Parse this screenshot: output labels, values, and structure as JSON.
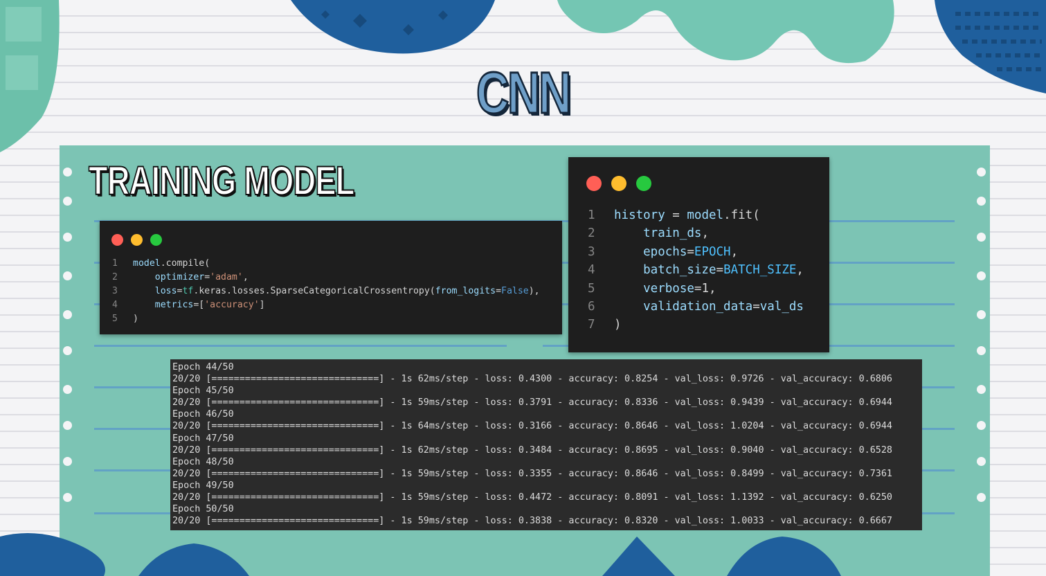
{
  "slide": {
    "title": "CNN",
    "section_title": "TRAINING MODEL"
  },
  "colors": {
    "panel": "#7cc4b4",
    "code_bg": "#1e1e1e",
    "terminal_bg": "#2b2b2b",
    "dot_red": "#ff5f56",
    "dot_yellow": "#ffbd2e",
    "dot_green": "#27c93f",
    "title_fill": "#6f9fc8"
  },
  "compile_code": {
    "lines": [
      {
        "num": "1",
        "tokens": [
          {
            "t": "model",
            "c": "tok-var"
          },
          {
            "t": ".compile(",
            "c": "tok-default"
          }
        ]
      },
      {
        "num": "2",
        "tokens": [
          {
            "t": "    optimizer",
            "c": "tok-var"
          },
          {
            "t": "=",
            "c": "tok-default"
          },
          {
            "t": "'adam'",
            "c": "tok-str"
          },
          {
            "t": ",",
            "c": "tok-default"
          }
        ]
      },
      {
        "num": "3",
        "tokens": [
          {
            "t": "    loss",
            "c": "tok-var"
          },
          {
            "t": "=",
            "c": "tok-default"
          },
          {
            "t": "tf",
            "c": "tok-cls"
          },
          {
            "t": ".keras.losses.SparseCategoricalCrossentropy(",
            "c": "tok-default"
          },
          {
            "t": "from_logits",
            "c": "tok-var"
          },
          {
            "t": "=",
            "c": "tok-default"
          },
          {
            "t": "False",
            "c": "tok-kw"
          },
          {
            "t": "),",
            "c": "tok-default"
          }
        ]
      },
      {
        "num": "4",
        "tokens": [
          {
            "t": "    metrics",
            "c": "tok-var"
          },
          {
            "t": "=[",
            "c": "tok-default"
          },
          {
            "t": "'accuracy'",
            "c": "tok-str"
          },
          {
            "t": "]",
            "c": "tok-default"
          }
        ]
      },
      {
        "num": "5",
        "tokens": [
          {
            "t": ")",
            "c": "tok-default"
          }
        ]
      }
    ]
  },
  "fit_code": {
    "lines": [
      {
        "num": "1",
        "tokens": [
          {
            "t": "history",
            "c": "tok-var"
          },
          {
            "t": " = ",
            "c": "tok-default"
          },
          {
            "t": "model",
            "c": "tok-var"
          },
          {
            "t": ".fit(",
            "c": "tok-default"
          }
        ]
      },
      {
        "num": "2",
        "tokens": [
          {
            "t": "    train_ds",
            "c": "tok-var"
          },
          {
            "t": ",",
            "c": "tok-default"
          }
        ]
      },
      {
        "num": "3",
        "tokens": [
          {
            "t": "    epochs",
            "c": "tok-var"
          },
          {
            "t": "=",
            "c": "tok-default"
          },
          {
            "t": "EPOCH",
            "c": "tok-const"
          },
          {
            "t": ",",
            "c": "tok-default"
          }
        ]
      },
      {
        "num": "4",
        "tokens": [
          {
            "t": "    batch_size",
            "c": "tok-var"
          },
          {
            "t": "=",
            "c": "tok-default"
          },
          {
            "t": "BATCH_SIZE",
            "c": "tok-const"
          },
          {
            "t": ",",
            "c": "tok-default"
          }
        ]
      },
      {
        "num": "5",
        "tokens": [
          {
            "t": "    verbose",
            "c": "tok-var"
          },
          {
            "t": "=1,",
            "c": "tok-default"
          }
        ]
      },
      {
        "num": "6",
        "tokens": [
          {
            "t": "    validation_data",
            "c": "tok-var"
          },
          {
            "t": "=",
            "c": "tok-default"
          },
          {
            "t": "val_ds",
            "c": "tok-var"
          }
        ]
      },
      {
        "num": "7",
        "tokens": [
          {
            "t": ")",
            "c": "tok-default"
          }
        ]
      }
    ]
  },
  "training_log": [
    "Epoch 44/50",
    "20/20 [==============================] - 1s 62ms/step - loss: 0.4300 - accuracy: 0.8254 - val_loss: 0.9726 - val_accuracy: 0.6806",
    "Epoch 45/50",
    "20/20 [==============================] - 1s 59ms/step - loss: 0.3791 - accuracy: 0.8336 - val_loss: 0.9439 - val_accuracy: 0.6944",
    "Epoch 46/50",
    "20/20 [==============================] - 1s 64ms/step - loss: 0.3166 - accuracy: 0.8646 - val_loss: 1.0204 - val_accuracy: 0.6944",
    "Epoch 47/50",
    "20/20 [==============================] - 1s 62ms/step - loss: 0.3484 - accuracy: 0.8695 - val_loss: 0.9040 - val_accuracy: 0.6528",
    "Epoch 48/50",
    "20/20 [==============================] - 1s 59ms/step - loss: 0.3355 - accuracy: 0.8646 - val_loss: 0.8499 - val_accuracy: 0.7361",
    "Epoch 49/50",
    "20/20 [==============================] - 1s 59ms/step - loss: 0.4472 - accuracy: 0.8091 - val_loss: 1.1392 - val_accuracy: 0.6250",
    "Epoch 50/50",
    "20/20 [==============================] - 1s 59ms/step - loss: 0.3838 - accuracy: 0.8320 - val_loss: 1.0033 - val_accuracy: 0.6667"
  ]
}
